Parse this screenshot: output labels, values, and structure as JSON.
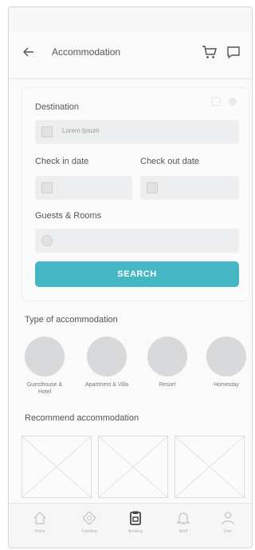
{
  "header": {
    "title": "Accommodation"
  },
  "form": {
    "destination_label": "Destination",
    "destination_placeholder": "Lorem Ipsum",
    "checkin_label": "Check in date",
    "checkout_label": "Check out date",
    "guests_label": "Guests & Rooms",
    "search_label": "SEARCH"
  },
  "types": {
    "title": "Type of accommodation",
    "items": [
      {
        "label": "Guesthouse & Hotel"
      },
      {
        "label": "Apartment & Villa"
      },
      {
        "label": "Resort"
      },
      {
        "label": "Homestay"
      }
    ]
  },
  "recommend": {
    "title": "Recommend accommodation"
  },
  "tabbar": {
    "items": [
      {
        "label": "Home",
        "icon": "home-icon"
      },
      {
        "label": "Trending",
        "icon": "explore-icon"
      },
      {
        "label": "Booking",
        "icon": "booking-icon"
      },
      {
        "label": "Notif",
        "icon": "bell-icon"
      },
      {
        "label": "User",
        "icon": "user-icon"
      }
    ]
  },
  "colors": {
    "accent": "#45b7c4",
    "placeholder_circle": "#d7d9db"
  }
}
